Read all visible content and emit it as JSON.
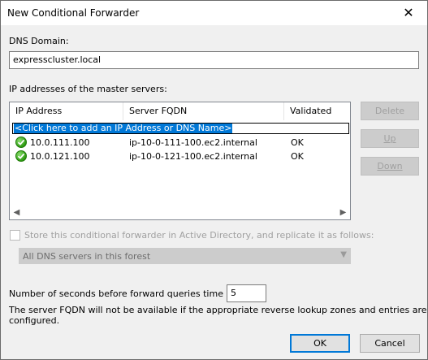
{
  "window": {
    "title": "New Conditional Forwarder",
    "close_glyph": "✕"
  },
  "dns_domain": {
    "label": "DNS Domain:",
    "value": "expresscluster.local"
  },
  "master_servers": {
    "label": "IP addresses of the master servers:",
    "columns": [
      "IP Address",
      "Server FQDN",
      "Validated"
    ],
    "add_prompt": "<Click here to add an IP Address or DNS Name>",
    "rows": [
      {
        "ip": "10.0.111.100",
        "fqdn": "ip-10-0-111-100.ec2.internal",
        "validated": "OK",
        "status_icon": "check-icon"
      },
      {
        "ip": "10.0.121.100",
        "fqdn": "ip-10-0-121-100.ec2.internal",
        "validated": "OK",
        "status_icon": "check-icon"
      }
    ]
  },
  "side_buttons": {
    "delete": "Delete",
    "up": "Up",
    "down": "Down"
  },
  "replicate": {
    "checkbox_label": "Store this conditional forwarder in Active Directory, and replicate it as follows:",
    "scope_selected": "All DNS servers in this forest"
  },
  "timeout": {
    "label": "Number of seconds before forward queries time out:",
    "value": "5"
  },
  "note": {
    "line1": "The server FQDN will not be available if the appropriate reverse lookup zones and entries are not",
    "line2": "configured."
  },
  "buttons": {
    "ok": "OK",
    "cancel": "Cancel"
  }
}
